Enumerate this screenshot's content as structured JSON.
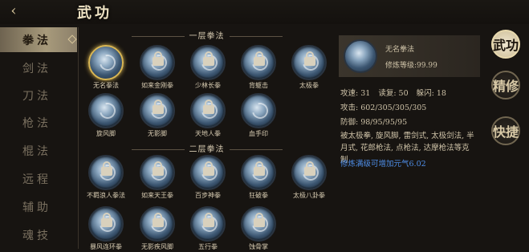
{
  "header": {
    "title": "武功",
    "back_icon": "back-arrow-icon"
  },
  "sidebar": {
    "categories": [
      {
        "label": "拳法",
        "active": true
      },
      {
        "label": "剑法",
        "active": false
      },
      {
        "label": "刀法",
        "active": false
      },
      {
        "label": "枪法",
        "active": false
      },
      {
        "label": "棍法",
        "active": false
      },
      {
        "label": "远程",
        "active": false
      },
      {
        "label": "辅助",
        "active": false
      },
      {
        "label": "魂技",
        "active": false
      }
    ]
  },
  "sections": [
    {
      "title": "一层拳法",
      "skills": [
        {
          "name": "无名拳法",
          "locked": false,
          "selected": true
        },
        {
          "name": "如来金刚拳",
          "locked": true
        },
        {
          "name": "少林长拳",
          "locked": true
        },
        {
          "name": "背躯击",
          "locked": true
        },
        {
          "name": "太极拳",
          "locked": true
        },
        {
          "name": "旋风脚",
          "locked": false
        },
        {
          "name": "无影脚",
          "locked": true
        },
        {
          "name": "天地人拳",
          "locked": true
        },
        {
          "name": "血手印",
          "locked": false
        }
      ]
    },
    {
      "title": "二层拳法",
      "skills": [
        {
          "name": "不羁浪人拳法",
          "locked": true
        },
        {
          "name": "如来天王拳",
          "locked": true
        },
        {
          "name": "百步神拳",
          "locked": true
        },
        {
          "name": "狂破拳",
          "locked": true
        },
        {
          "name": "太极八卦拳",
          "locked": true
        },
        {
          "name": "暴风连环拳",
          "locked": true
        },
        {
          "name": "无影疾风脚",
          "locked": true
        },
        {
          "name": "五行拳",
          "locked": true
        },
        {
          "name": "蚀骨掌",
          "locked": true
        }
      ]
    }
  ],
  "detail": {
    "name": "无名拳法",
    "level": "修炼等级:99.99",
    "stats": {
      "attack_speed": "攻速: 31",
      "bad_speed": "读复: 50",
      "dodge": "躲闪: 18",
      "attack": "攻击: 602/305/305/305",
      "defense": "防御: 98/95/95/95"
    },
    "description": "被太极拳, 旋风脚, 雷剑式, 太极剑法, 半月式, 花郎枪法, 点枪法, 达摩枪法等克制",
    "bonus": "修炼满级可增加元气6.02"
  },
  "menu": [
    {
      "label": "武功",
      "active": true
    },
    {
      "label": "精修",
      "active": false
    },
    {
      "label": "快捷",
      "active": false
    }
  ],
  "colors": {
    "accent": "#d9b653",
    "bonus_text": "#4e8de6"
  }
}
